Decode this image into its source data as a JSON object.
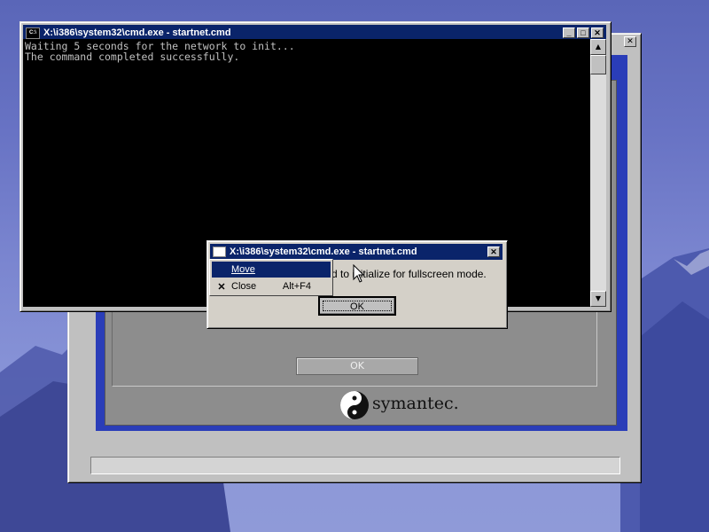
{
  "desktop": {
    "background_color": "#6a74c4"
  },
  "symantec_window": {
    "close_label": "✕",
    "ok_button_label": "OK",
    "logo_text": "symantec.",
    "blue_border_color": "#2a3db8"
  },
  "cmd_window": {
    "icon_label": "C:\\",
    "title": "X:\\i386\\system32\\cmd.exe - startnet.cmd",
    "buttons": {
      "minimize": "_",
      "maximize": "□",
      "close": "✕"
    },
    "console_lines": [
      "Waiting 5 seconds for the network to init...",
      "The command completed successfully."
    ],
    "scroll_up": "▲",
    "scroll_down": "▼"
  },
  "dialog": {
    "title": "X:\\i386\\system32\\cmd.exe - startnet.cmd",
    "close_label": "✕",
    "message": "d to initialize for fullscreen mode.",
    "ok_label": "OK"
  },
  "context_menu": {
    "items": [
      {
        "label": "Move",
        "accelerator": "",
        "check": "",
        "selected": true
      },
      {
        "label": "Close",
        "accelerator": "Alt+F4",
        "check": "✕",
        "selected": false
      }
    ]
  },
  "colors": {
    "titlebar_active": "#0a246a",
    "window_face": "#c0c0c0",
    "console_bg": "#000000",
    "console_fg": "#c0c0c0"
  }
}
